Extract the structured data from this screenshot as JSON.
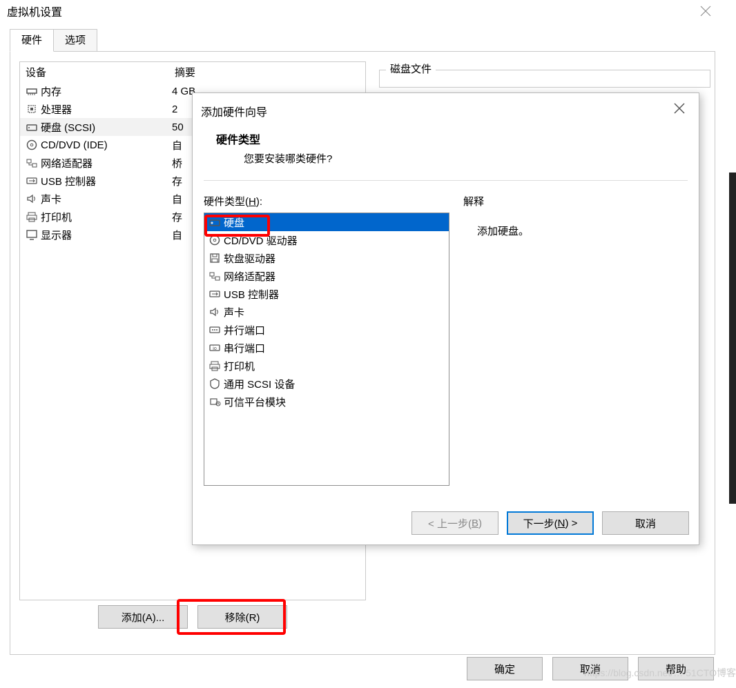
{
  "main": {
    "title": "虚拟机设置",
    "tabs": {
      "hardware": "硬件",
      "options": "选项"
    },
    "device_header": "设备",
    "summary_header": "摘要",
    "devices": [
      {
        "icon": "memory-icon",
        "label": "内存",
        "value": "4 GB"
      },
      {
        "icon": "cpu-icon",
        "label": "处理器",
        "value": "2"
      },
      {
        "icon": "disk-icon",
        "label": "硬盘 (SCSI)",
        "value": "50",
        "selected": true
      },
      {
        "icon": "cd-icon",
        "label": "CD/DVD (IDE)",
        "value": "自"
      },
      {
        "icon": "network-icon",
        "label": "网络适配器",
        "value": "桥"
      },
      {
        "icon": "usb-icon",
        "label": "USB 控制器",
        "value": "存"
      },
      {
        "icon": "sound-icon",
        "label": "声卡",
        "value": "自"
      },
      {
        "icon": "printer-icon",
        "label": "打印机",
        "value": "存"
      },
      {
        "icon": "display-icon",
        "label": "显示器",
        "value": "自"
      }
    ],
    "disk_file_label": "磁盘文件",
    "add_btn": "添加(A)...",
    "remove_btn": "移除(R)",
    "ok_btn": "确定",
    "cancel_btn": "取消",
    "help_btn": "帮助"
  },
  "wizard": {
    "title": "添加硬件向导",
    "head_title": "硬件类型",
    "head_sub": "您要安装哪类硬件?",
    "list_label": "硬件类型(H):",
    "items": [
      {
        "icon": "disk-icon",
        "label": "硬盘",
        "selected": true
      },
      {
        "icon": "cd-icon",
        "label": "CD/DVD 驱动器"
      },
      {
        "icon": "floppy-icon",
        "label": "软盘驱动器"
      },
      {
        "icon": "network-icon",
        "label": "网络适配器"
      },
      {
        "icon": "usb-icon",
        "label": "USB 控制器"
      },
      {
        "icon": "sound-icon",
        "label": "声卡"
      },
      {
        "icon": "parallel-icon",
        "label": "并行端口"
      },
      {
        "icon": "serial-icon",
        "label": "串行端口"
      },
      {
        "icon": "printer-icon",
        "label": "打印机"
      },
      {
        "icon": "scsi-icon",
        "label": "通用 SCSI 设备"
      },
      {
        "icon": "tpm-icon",
        "label": "可信平台模块"
      }
    ],
    "explain_label": "解释",
    "explain_text": "添加硬盘。",
    "back_btn": "< 上一步(B)",
    "next_btn": "下一步(N) >",
    "cancel_btn": "取消"
  },
  "watermark": "https://blog.csdn.net/… 51CTO博客"
}
